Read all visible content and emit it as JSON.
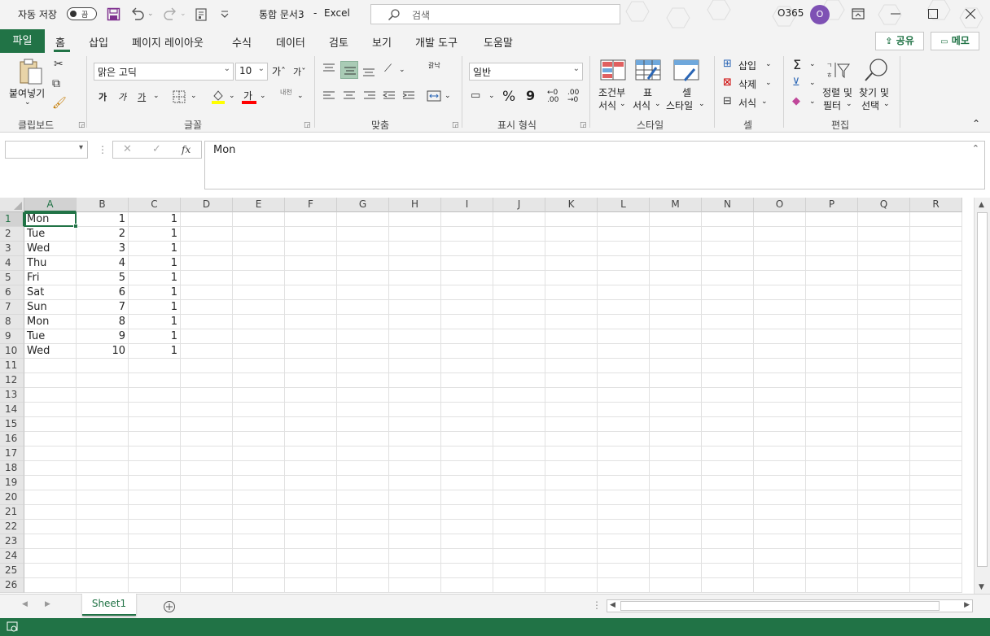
{
  "title_bar": {
    "autosave_label": "자동 저장",
    "autosave_state": "끔",
    "doc_title": "통합 문서3",
    "separator": "-",
    "app_name": "Excel",
    "search_placeholder": "검색",
    "account_label": "O365",
    "avatar_initial": "O"
  },
  "ribbon_tabs": [
    "파일",
    "홈",
    "삽입",
    "페이지 레이아웃",
    "수식",
    "데이터",
    "검토",
    "보기",
    "개발 도구",
    "도움말"
  ],
  "top_buttons": {
    "share": "공유",
    "memo": "메모"
  },
  "ribbon": {
    "clipboard": {
      "paste": "붙여넣기",
      "group": "클립보드"
    },
    "font": {
      "font_name": "맑은 고딕",
      "font_size": "10",
      "group": "글꼴",
      "bold": "가",
      "italic": "가",
      "underline": "가",
      "font_color_glyph": "가",
      "phonetic": "내천"
    },
    "alignment": {
      "group": "맞춤",
      "wrap": "갉낙"
    },
    "number": {
      "format": "일반",
      "group": "표시 형식",
      "percent": "%",
      "comma": "9"
    },
    "styles": {
      "conditional": [
        "조건부",
        "서식"
      ],
      "table": [
        "표",
        "서식"
      ],
      "cell": [
        "셀",
        "스타일"
      ],
      "group": "스타일"
    },
    "cells": {
      "insert": "삽입",
      "delete": "삭제",
      "format": "서식",
      "group": "셀"
    },
    "editing": {
      "sort": [
        "정렬 및",
        "필터"
      ],
      "find": [
        "찾기 및",
        "선택"
      ],
      "sum": "Σ",
      "group": "편집"
    }
  },
  "formula_bar": {
    "name_box": "",
    "fx": "fx",
    "formula": "Mon"
  },
  "columns": [
    "A",
    "B",
    "C",
    "D",
    "E",
    "F",
    "G",
    "H",
    "I",
    "J",
    "K",
    "L",
    "M",
    "N",
    "O",
    "P",
    "Q",
    "R"
  ],
  "rows": [
    "1",
    "2",
    "3",
    "4",
    "5",
    "6",
    "7",
    "8",
    "9",
    "10",
    "11",
    "12",
    "13",
    "14",
    "15",
    "16",
    "17",
    "18",
    "19",
    "20",
    "21",
    "22",
    "23",
    "24",
    "25",
    "26"
  ],
  "cells": {
    "A": [
      "Mon",
      "Tue",
      "Wed",
      "Thu",
      "Fri",
      "Sat",
      "Sun",
      "Mon",
      "Tue",
      "Wed"
    ],
    "B": [
      "1",
      "2",
      "3",
      "4",
      "5",
      "6",
      "7",
      "8",
      "9",
      "10"
    ],
    "C": [
      "1",
      "1",
      "1",
      "1",
      "1",
      "1",
      "1",
      "1",
      "1",
      "1"
    ]
  },
  "active_cell": "A1",
  "sheets": [
    "Sheet1"
  ],
  "colors": {
    "accent": "#217346",
    "avatar": "#7e51b4"
  }
}
